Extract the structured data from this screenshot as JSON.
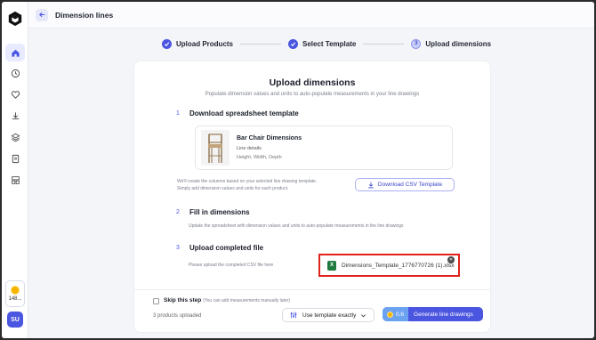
{
  "header": {
    "title": "Dimension lines"
  },
  "sidebar": {
    "items": [
      {
        "name": "home-icon",
        "active": true
      },
      {
        "name": "clock-icon",
        "active": false
      },
      {
        "name": "heart-icon",
        "active": false
      },
      {
        "name": "download-icon",
        "active": false
      },
      {
        "name": "layers-icon",
        "active": false
      },
      {
        "name": "document-icon",
        "active": false
      },
      {
        "name": "blocks-icon",
        "active": false
      }
    ],
    "credits": "148...",
    "avatar": "SU"
  },
  "stepper": {
    "steps": [
      {
        "label": "Upload Products",
        "state": "done"
      },
      {
        "label": "Select Template",
        "state": "done"
      },
      {
        "label": "Upload dimensions",
        "state": "current",
        "number": "3"
      }
    ]
  },
  "card": {
    "title": "Upload dimensions",
    "subtitle": "Populate dimension values and units to auto-populate measurements in your line drawings",
    "section1": {
      "number": "1",
      "title": "Download spreadsheet template",
      "product": {
        "name": "Bar Chair Dimensions",
        "line1": "Line details",
        "line2": "Height, Width, Depth"
      },
      "hint_line1": "We'll create the columns based on your selected line drawing template.",
      "hint_line2": "Simply add dimension values and units for each product.",
      "button": "Download CSV Template"
    },
    "section2": {
      "number": "2",
      "title": "Fill in dimensions",
      "hint": "Update the spreadsheet with dimension values and units to auto-populate measurements in the line drawings"
    },
    "section3": {
      "number": "3",
      "title": "Upload completed file",
      "hint": "Please upload the completed CSV file here",
      "file_name": "Dimensions_Template_1776770726 (1).xlsx",
      "file_badge": "X"
    },
    "footer": {
      "skip_label": "Skip this step",
      "skip_note": "(You can add measurements manually later)",
      "uploaded": "3 products uploaded",
      "template_select": "Use template exactly",
      "cost": "0.6",
      "generate": "Generate line drawings"
    }
  },
  "colors": {
    "accent": "#4a55e0",
    "highlight": "#e0221c",
    "excel": "#1f7a40"
  }
}
